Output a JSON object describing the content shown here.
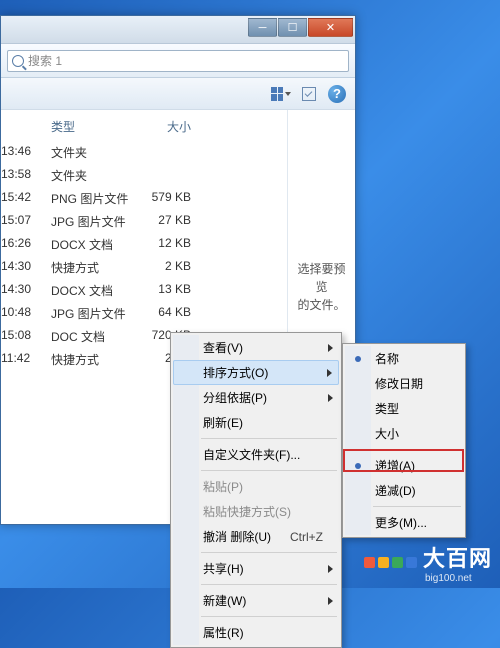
{
  "window": {
    "search_placeholder": "搜索 1"
  },
  "columns": {
    "type": "类型",
    "size": "大小"
  },
  "files": [
    {
      "date": "13:46",
      "type": "文件夹",
      "size": ""
    },
    {
      "date": "13:58",
      "type": "文件夹",
      "size": ""
    },
    {
      "date": "15:42",
      "type": "PNG 图片文件",
      "size": "579 KB"
    },
    {
      "date": "15:07",
      "type": "JPG 图片文件",
      "size": "27 KB"
    },
    {
      "date": "16:26",
      "type": "DOCX 文档",
      "size": "12 KB"
    },
    {
      "date": "14:30",
      "type": "快捷方式",
      "size": "2 KB"
    },
    {
      "date": "14:30",
      "type": "DOCX 文档",
      "size": "13 KB"
    },
    {
      "date": "10:48",
      "type": "JPG 图片文件",
      "size": "64 KB"
    },
    {
      "date": "15:08",
      "type": "DOC 文档",
      "size": "720 KB"
    },
    {
      "date": "11:42",
      "type": "快捷方式",
      "size": "2 KB"
    }
  ],
  "preview": {
    "line1": "选择要预览",
    "line2": "的文件。"
  },
  "menu1": {
    "view": "查看(V)",
    "sort": "排序方式(O)",
    "group": "分组依据(P)",
    "refresh": "刷新(E)",
    "customize": "自定义文件夹(F)...",
    "paste": "粘贴(P)",
    "paste_shortcut": "粘贴快捷方式(S)",
    "undo": "撤消 删除(U)",
    "undo_key": "Ctrl+Z",
    "share": "共享(H)",
    "new": "新建(W)",
    "properties": "属性(R)"
  },
  "menu2": {
    "name": "名称",
    "date": "修改日期",
    "type": "类型",
    "size": "大小",
    "asc": "递增(A)",
    "desc": "递减(D)",
    "more": "更多(M)..."
  },
  "brand": {
    "name": "大百网",
    "sub": "big100.net"
  }
}
